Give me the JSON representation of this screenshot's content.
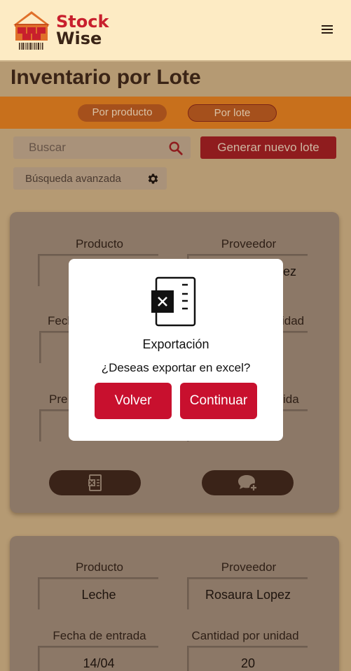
{
  "header": {
    "logo_line1": "Stock",
    "logo_line2": "Wise",
    "menu_icon": "hamburger-menu-icon"
  },
  "page": {
    "title": "Inventario por Lote"
  },
  "tabs": [
    {
      "label": "Por producto"
    },
    {
      "label": "Por lote"
    }
  ],
  "search": {
    "placeholder": "Buscar",
    "icon": "search-icon"
  },
  "actions": {
    "generate_label": "Generar nuevo lote"
  },
  "advanced_search": {
    "placeholder": "Búsqueda avanzada",
    "icon": "gear-icon"
  },
  "cards": [
    {
      "producto_label": "Producto",
      "producto_value": "",
      "proveedor_label": "Proveedor",
      "proveedor_value": "ez",
      "fecha_label": "Fech",
      "cantidad_label": "idad",
      "precio_label": "Pre",
      "otro_label": "ida"
    },
    {
      "producto_label": "Producto",
      "producto_value": "Leche",
      "proveedor_label": "Proveedor",
      "proveedor_value": "Rosaura Lopez",
      "fecha_label": "Fecha de entrada",
      "fecha_value": "14/04",
      "cantidad_label": "Cantidad por unidad",
      "cantidad_value": "20"
    }
  ],
  "modal": {
    "title": "Exportación",
    "question": "¿Deseas exportar en excel?",
    "back_label": "Volver",
    "continue_label": "Continuar"
  },
  "colors": {
    "brand_red": "#c8102e",
    "header_bg": "#fdebc4",
    "tabs_bg": "#c8701c"
  }
}
